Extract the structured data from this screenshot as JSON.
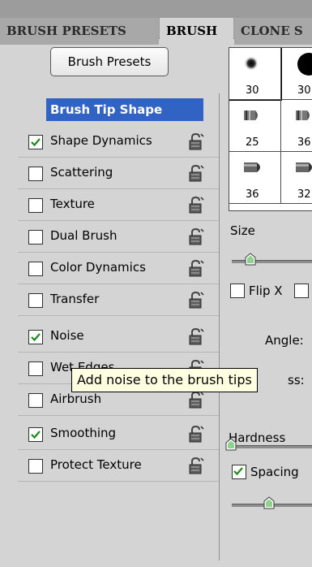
{
  "tabs": [
    {
      "label": "BRUSH PRESETS"
    },
    {
      "label": "BRUSH"
    },
    {
      "label": "CLONE S"
    }
  ],
  "presets_button": "Brush Presets",
  "tip_shape": "Brush Tip Shape",
  "options": [
    {
      "label": "Shape Dynamics",
      "checked": true,
      "lock_icon": "lock-icon"
    },
    {
      "label": "Scattering",
      "checked": false,
      "lock_icon": "lock-icon"
    },
    {
      "label": "Texture",
      "checked": false,
      "lock_icon": "lock-icon"
    },
    {
      "label": "Dual Brush",
      "checked": false,
      "lock_icon": "lock-icon"
    },
    {
      "label": "Color Dynamics",
      "checked": false,
      "lock_icon": "lock-icon"
    },
    {
      "label": "Transfer",
      "checked": false,
      "lock_icon": "lock-icon"
    },
    {
      "label": "Noise",
      "checked": true,
      "lock_icon": "lock-icon"
    },
    {
      "label": "Wet Edges",
      "checked": false,
      "lock_icon": "lock-icon"
    },
    {
      "label": "Airbrush",
      "checked": false,
      "lock_icon": "lock-icon"
    },
    {
      "label": "Smoothing",
      "checked": true,
      "lock_icon": "lock-icon"
    },
    {
      "label": "Protect Texture",
      "checked": false,
      "lock_icon": "lock-icon"
    }
  ],
  "preset_grid": [
    {
      "label": "30"
    },
    {
      "label": "30"
    },
    {
      "label": "25"
    },
    {
      "label": "36"
    },
    {
      "label": "36"
    },
    {
      "label": "32"
    }
  ],
  "right": {
    "size_label": "Size",
    "flip_x_label": "Flip X",
    "angle_label": "Angle:",
    "roundness_label": "ss:",
    "hardness_label": "Hardness",
    "spacing_label": "Spacing",
    "spacing_checked": true
  },
  "tooltip": "Add noise to the brush tips",
  "colors": {
    "selection": "#3163c5",
    "check": "#1a8a1a",
    "tooltip_bg": "#ffffe1"
  }
}
